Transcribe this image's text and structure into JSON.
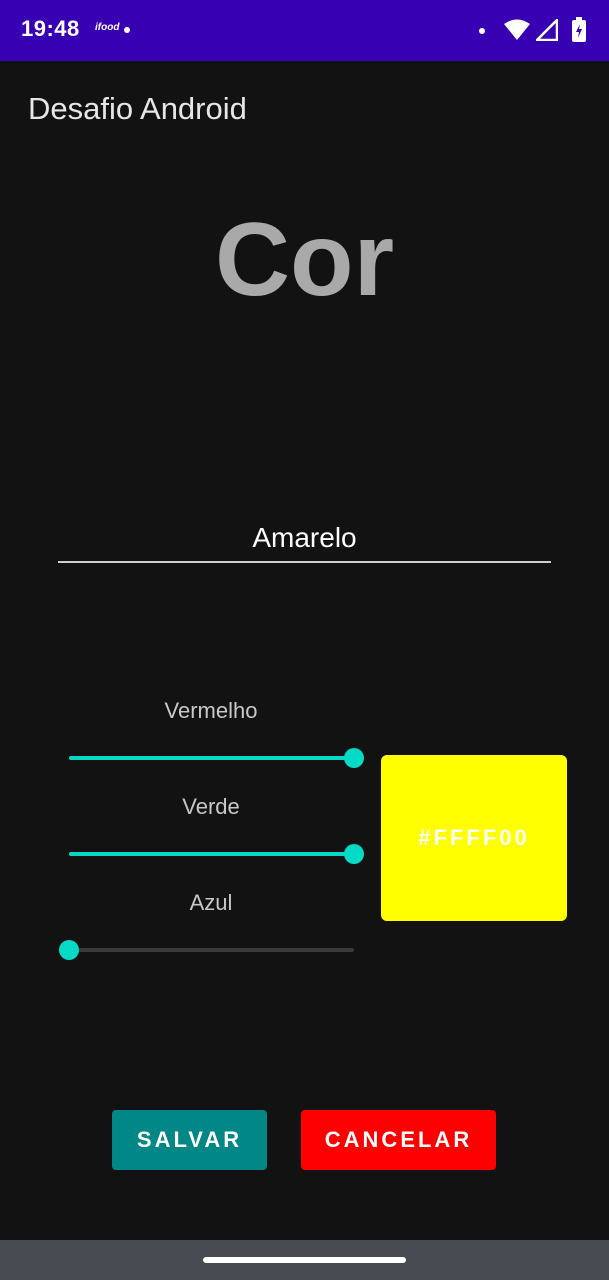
{
  "status_bar": {
    "time": "19:48",
    "app_icon_text": "ifood",
    "icons": [
      "ifood-icon",
      "notification-dot-icon",
      "wifi-icon",
      "signal-icon",
      "battery-icon"
    ]
  },
  "app_bar": {
    "title": "Desafio Android"
  },
  "header": {
    "title": "Cor"
  },
  "color_name_field": {
    "value": "Amarelo"
  },
  "sliders": [
    {
      "label": "Vermelho",
      "value": 255,
      "max": 255
    },
    {
      "label": "Verde",
      "value": 255,
      "max": 255
    },
    {
      "label": "Azul",
      "value": 0,
      "max": 255
    }
  ],
  "preview": {
    "hex": "#FFFF00",
    "color": "#FFFF00"
  },
  "buttons": {
    "save_label": "SALVAR",
    "cancel_label": "CANCELAR"
  },
  "colors": {
    "status_bar": "#3700B3",
    "background": "#121212",
    "accent": "#03DAC5",
    "save_button": "#018786",
    "cancel_button": "#FF0000"
  }
}
